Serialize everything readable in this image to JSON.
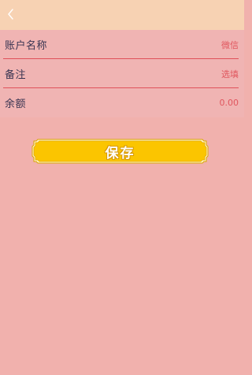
{
  "header": {
    "back_icon": "chevron-left-icon"
  },
  "form": {
    "rows": [
      {
        "label": "账户名称",
        "value": "微信"
      },
      {
        "label": "备注",
        "value": "选填"
      },
      {
        "label": "余额",
        "value": "0.00"
      }
    ]
  },
  "actions": {
    "save_label": "保存"
  },
  "colors": {
    "header_bg": "#f7d2b3",
    "page_bg": "#f1b1ad",
    "divider": "#e0515a",
    "button_fill": "#fbc500",
    "label_text": "#3a3552",
    "value_text": "#e0565e"
  }
}
